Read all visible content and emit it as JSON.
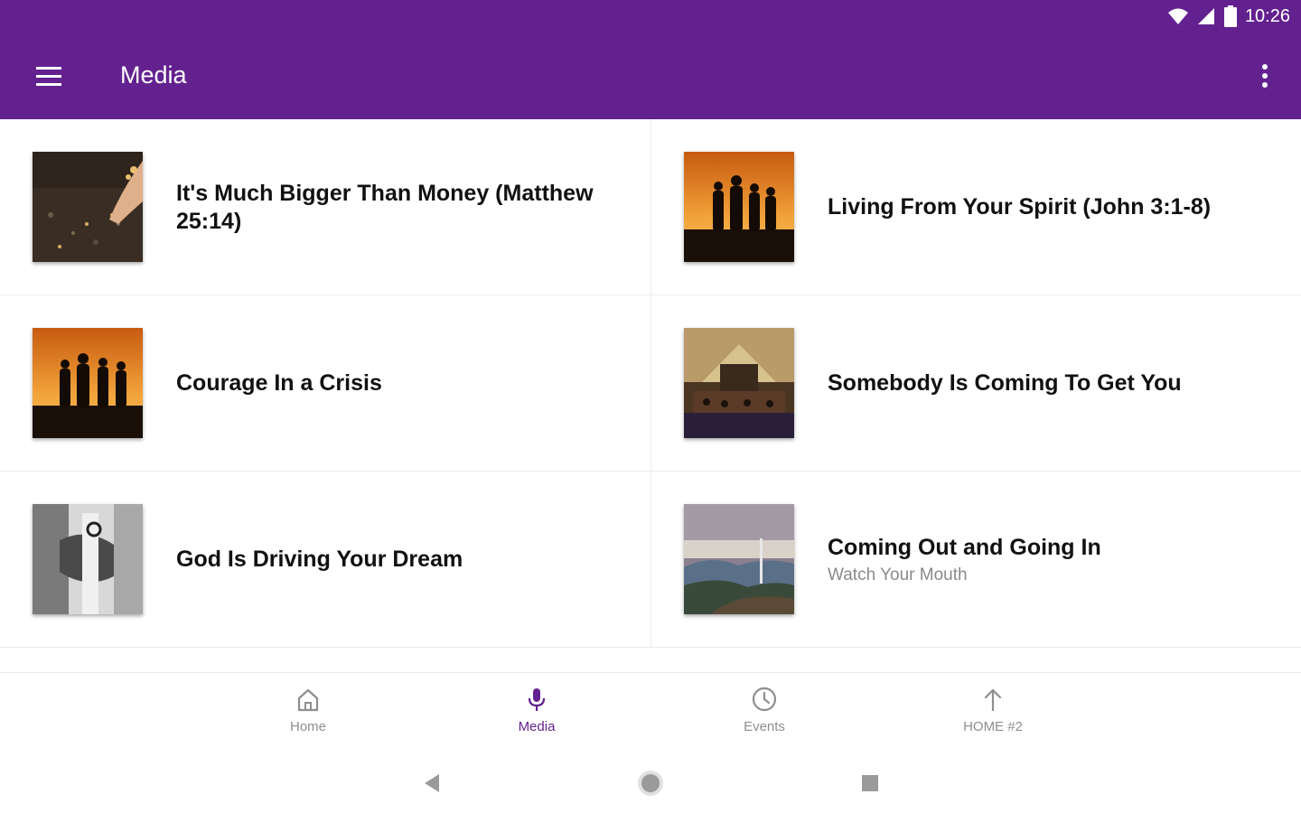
{
  "status_bar": {
    "time": "10:26",
    "icons": [
      "wifi-icon",
      "signal-icon",
      "battery-icon"
    ]
  },
  "app_bar": {
    "title": "Media",
    "left_icon": "menu-icon",
    "right_icon": "more-vert-icon",
    "color": "#63218f"
  },
  "media_items": [
    {
      "title": "It's Much Bigger Than Money (Matthew 25:14)",
      "subtitle": ""
    },
    {
      "title": "Living From Your Spirit (John 3:1-8)",
      "subtitle": ""
    },
    {
      "title": "Courage In a Crisis",
      "subtitle": ""
    },
    {
      "title": "Somebody Is Coming To Get You",
      "subtitle": ""
    },
    {
      "title": "God Is Driving Your Dream",
      "subtitle": ""
    },
    {
      "title": "Coming Out and Going In",
      "subtitle": "Watch Your Mouth"
    }
  ],
  "bottom_nav": {
    "items": [
      {
        "label": "Home",
        "icon": "home-icon"
      },
      {
        "label": "Media",
        "icon": "microphone-icon",
        "active": true
      },
      {
        "label": "Events",
        "icon": "clock-icon"
      },
      {
        "label": "HOME #2",
        "icon": "arrow-up-icon"
      }
    ],
    "active_color": "#63218f",
    "inactive_color": "#8e8e8e"
  },
  "system_nav": [
    "back-icon",
    "home-circle-icon",
    "recents-icon"
  ]
}
